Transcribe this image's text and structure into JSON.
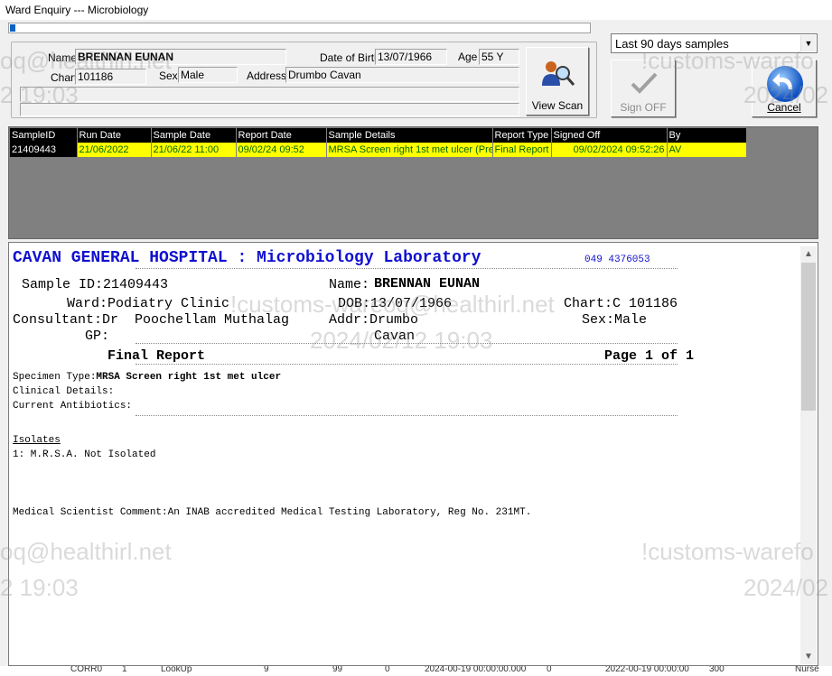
{
  "window": {
    "title": "Ward Enquiry --- Microbiology"
  },
  "patient": {
    "name_label": "Name",
    "name": "BRENNAN EUNAN",
    "dob_label": "Date of Birth",
    "dob": "13/07/1966",
    "age_label": "Age",
    "age": "55 Y",
    "chart_label": "Chart",
    "chart": "101186",
    "sex_label": "Sex",
    "sex": "Male",
    "address_label": "Address",
    "address": "Drumbo Cavan"
  },
  "buttons": {
    "view_scan": "View Scan",
    "sign_off": "Sign OFF",
    "cancel": "Cancel"
  },
  "filter": {
    "selected": "Last 90 days samples"
  },
  "grid": {
    "columns": [
      "SampleID",
      "Run Date",
      "Sample Date",
      "Report Date",
      "Sample Details",
      "Report Type",
      "Signed Off",
      "By"
    ],
    "rows": [
      [
        "21409443",
        "21/06/2022",
        "21/06/22 11:00",
        "09/02/24 09:52",
        "MRSA Screen right 1st met ulcer  (Pre",
        "Final Report",
        "09/02/2024 09:52:26",
        "AV"
      ]
    ]
  },
  "report": {
    "hospital": "CAVAN GENERAL HOSPITAL : Microbiology Laboratory",
    "phone": "049 4376053",
    "sample_id_line": "Sample ID:21409443",
    "name_label": "Name:",
    "name": "BRENNAN EUNAN",
    "ward_line": "Ward:Podiatry Clinic",
    "dob_line": "DOB:13/07/1966",
    "chart_line": "Chart:C 101186",
    "consultant_line": "Consultant:Dr  Poochellam Muthalag",
    "addr_line": "Addr:Drumbo",
    "sex_line": "Sex:Male",
    "gp_line": "GP:",
    "addr_line2": "Cavan",
    "report_type": "Final Report",
    "page": "Page 1 of 1",
    "specimen_label": "Specimen Type:",
    "specimen": "MRSA Screen right 1st met ulcer",
    "clinical": "Clinical Details:",
    "antibiotics": "Current Antibiotics:",
    "isolates_header": "Isolates",
    "isolate_1": "1: M.R.S.A. Not Isolated",
    "comment": "Medical Scientist Comment:An INAB accredited Medical Testing Laboratory, Reg No. 231MT."
  },
  "watermarks": {
    "email_a": "oq@healthirl.net",
    "email_b": "!customs-warefo",
    "time_a": "2 19:03",
    "time_b": "2024/02",
    "center_a": "!customs-wareoq@healthirl.net",
    "center_b": "2024/02/12 19:03",
    "top_a": "oq@healthirl.net",
    "top_b": "!customs-warefo",
    "top_time_a": "2 19:03",
    "top_time_b": "2024/02"
  },
  "background_strip": [
    "CORR0",
    "1",
    "LookUp",
    "9",
    "99",
    "0",
    "2024-00-19 00:00:00.000",
    "0",
    "2022-00-19 00:00:00",
    "300",
    "Nurse"
  ]
}
